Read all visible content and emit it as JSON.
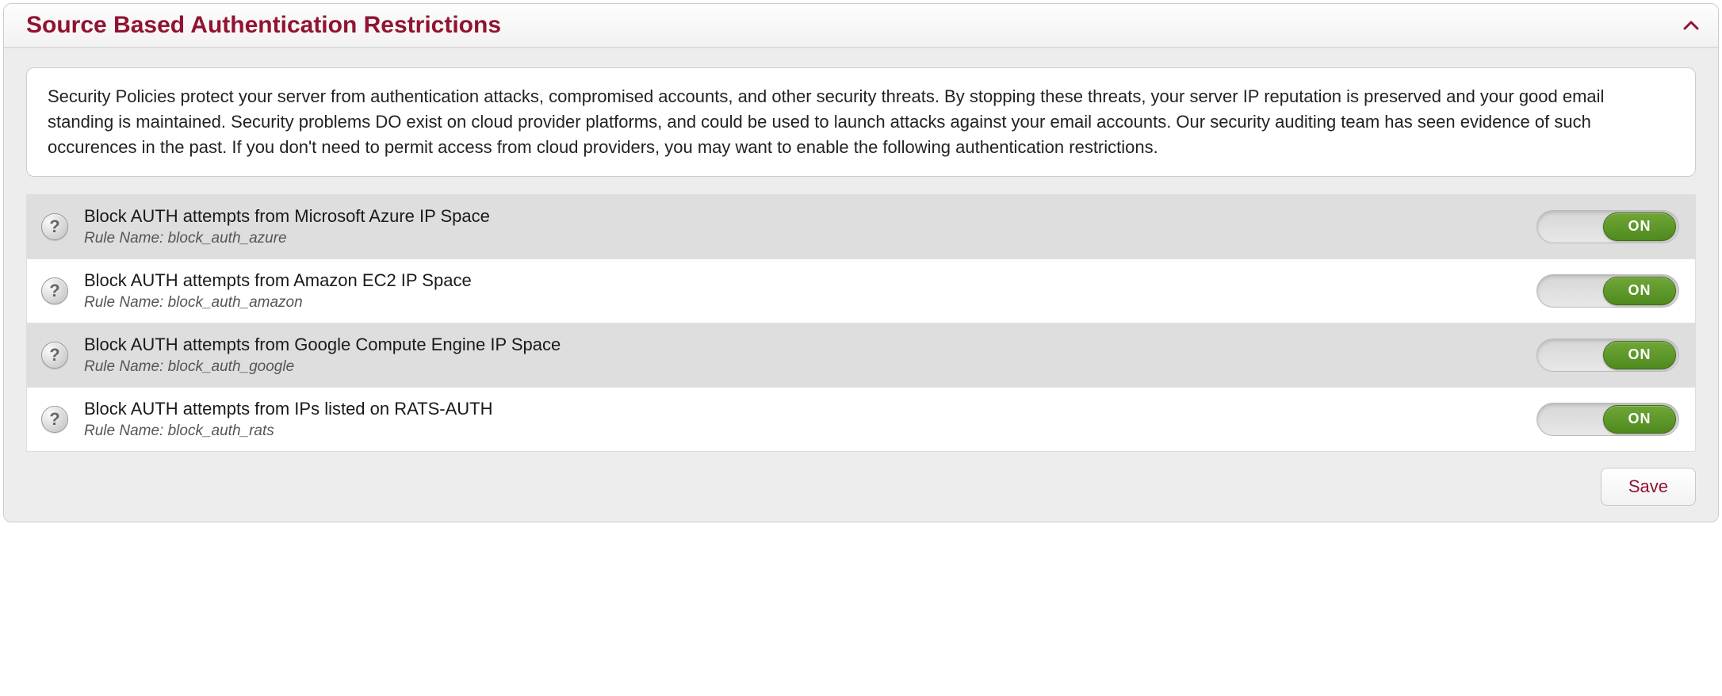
{
  "panel": {
    "title": "Source Based Authentication Restrictions",
    "description": "Security Policies protect your server from authentication attacks, compromised accounts, and other security threats. By stopping these threats, your server IP reputation is preserved and your good email standing is maintained. Security problems DO exist on cloud provider platforms, and could be used to launch attacks against your email accounts. Our security auditing team has seen evidence of such occurences in the past. If you don't need to permit access from cloud providers, you may want to enable the following authentication restrictions."
  },
  "labels": {
    "rule_name_prefix": "Rule Name: ",
    "toggle_on": "ON",
    "save": "Save",
    "help": "?"
  },
  "rules": [
    {
      "title": "Block AUTH attempts from Microsoft Azure IP Space",
      "rule_name": "block_auth_azure",
      "state": "ON"
    },
    {
      "title": "Block AUTH attempts from Amazon EC2 IP Space",
      "rule_name": "block_auth_amazon",
      "state": "ON"
    },
    {
      "title": "Block AUTH attempts from Google Compute Engine IP Space",
      "rule_name": "block_auth_google",
      "state": "ON"
    },
    {
      "title": "Block AUTH attempts from IPs listed on RATS-AUTH",
      "rule_name": "block_auth_rats",
      "state": "ON"
    }
  ]
}
